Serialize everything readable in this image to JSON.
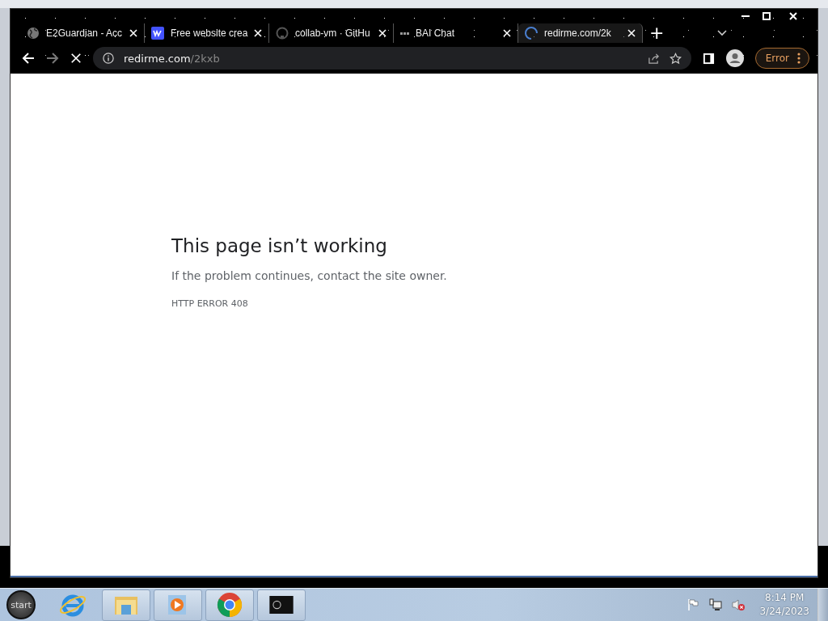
{
  "tabs": [
    {
      "kind": "globe",
      "title": "E2Guardian - Acc",
      "selected": false
    },
    {
      "kind": "w",
      "title": "Free website crea",
      "selected": false
    },
    {
      "kind": "github",
      "title": "collab-vm · GitHu",
      "selected": false
    },
    {
      "kind": "bars",
      "title": "BAI Chat",
      "selected": false
    },
    {
      "kind": "spinner",
      "title": "redirme.com/2k",
      "selected": true
    }
  ],
  "new_tab": "+",
  "address": {
    "host": "redirme.com",
    "path": "/2kxb"
  },
  "error_button": "Error",
  "page": {
    "heading": "This page isn’t working",
    "message": "If the problem continues, contact the site owner.",
    "code": "HTTP ERROR 408"
  },
  "taskbar": {
    "start": "start",
    "apps": [
      {
        "kind": "ie"
      },
      {
        "kind": "folder"
      },
      {
        "kind": "media"
      },
      {
        "kind": "chrome"
      },
      {
        "kind": "terminal"
      }
    ],
    "time": "8:14 PM",
    "date": "3/24/2023"
  }
}
